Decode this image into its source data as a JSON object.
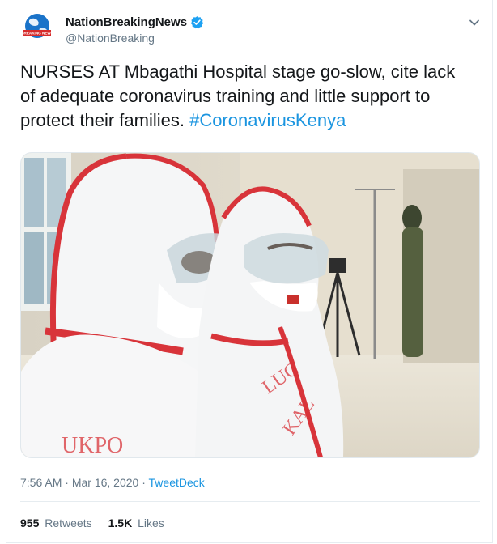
{
  "account": {
    "display_name": "NationBreakingNews",
    "handle": "@NationBreaking",
    "verified": true,
    "avatar_label": "BREAKING NEWS"
  },
  "tweet": {
    "text": "NURSES AT Mbagathi Hospital stage go-slow, cite lack of adequate coronavirus training and little support to protect their families. ",
    "hashtag": "#CoronavirusKenya"
  },
  "media": {
    "suit_text_left": "UKPO",
    "suit_text_right_1": "LUC",
    "suit_text_right_2": "KAL"
  },
  "meta": {
    "time": "7:56 AM",
    "separator_1": " · ",
    "date": "Mar 16, 2020",
    "separator_2": " · ",
    "source": "TweetDeck"
  },
  "stats": {
    "retweets_count": "955",
    "retweets_label": "Retweets",
    "likes_count": "1.5K",
    "likes_label": "Likes"
  },
  "icons": {
    "verified": "verified-badge-icon",
    "more": "chevron-down-icon"
  },
  "colors": {
    "link": "#1b95e0",
    "secondary_text": "#657786",
    "primary_text": "#14171a",
    "verified": "#1da1f2"
  }
}
